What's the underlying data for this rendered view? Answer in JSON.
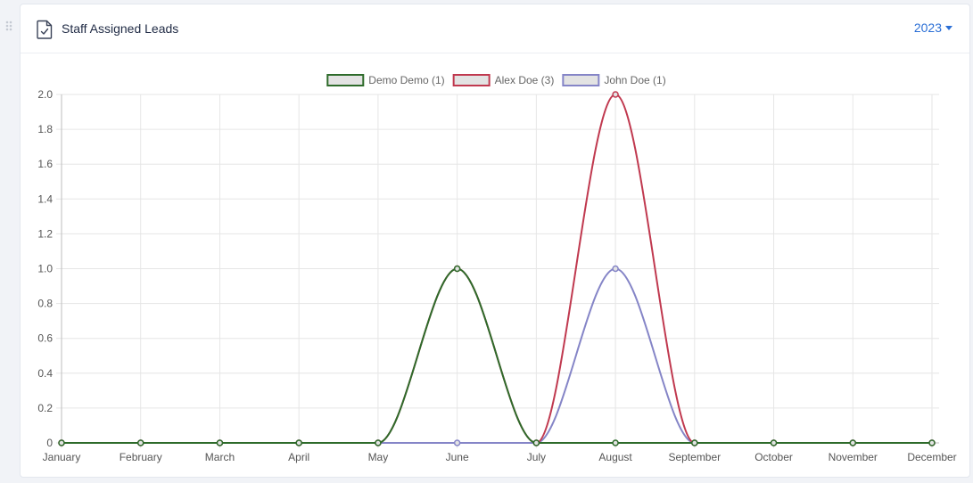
{
  "header": {
    "title": "Staff Assigned Leads",
    "year": "2023"
  },
  "colors": {
    "accent": "#2b6fd6",
    "title": "#1f2a44"
  },
  "icons": {
    "drag": "drag-handle-icon",
    "header": "file-check-icon",
    "year_dropdown": "caret-down-icon"
  },
  "chart_data": {
    "type": "line",
    "categories": [
      "January",
      "February",
      "March",
      "April",
      "May",
      "June",
      "July",
      "August",
      "September",
      "October",
      "November",
      "December"
    ],
    "ylim": [
      0,
      2
    ],
    "yticks": [
      "0",
      "0.2",
      "0.4",
      "0.6",
      "0.8",
      "1.0",
      "1.2",
      "1.4",
      "1.6",
      "1.8",
      "2.0"
    ],
    "grid": true,
    "legend_position": "top",
    "series": [
      {
        "name": "Demo Demo (1)",
        "color": "#2e6b2b",
        "values": [
          0,
          0,
          0,
          0,
          0,
          1,
          0,
          0,
          0,
          0,
          0,
          0
        ]
      },
      {
        "name": "Alex Doe (3)",
        "color": "#c0394f",
        "values": [
          0,
          0,
          0,
          0,
          0,
          1,
          0,
          2,
          0,
          0,
          0,
          0
        ]
      },
      {
        "name": "John Doe (1)",
        "color": "#8585c7",
        "values": [
          0,
          0,
          0,
          0,
          0,
          0,
          0,
          1,
          0,
          0,
          0,
          0
        ]
      }
    ],
    "draw_order": [
      2,
      1,
      0
    ]
  }
}
